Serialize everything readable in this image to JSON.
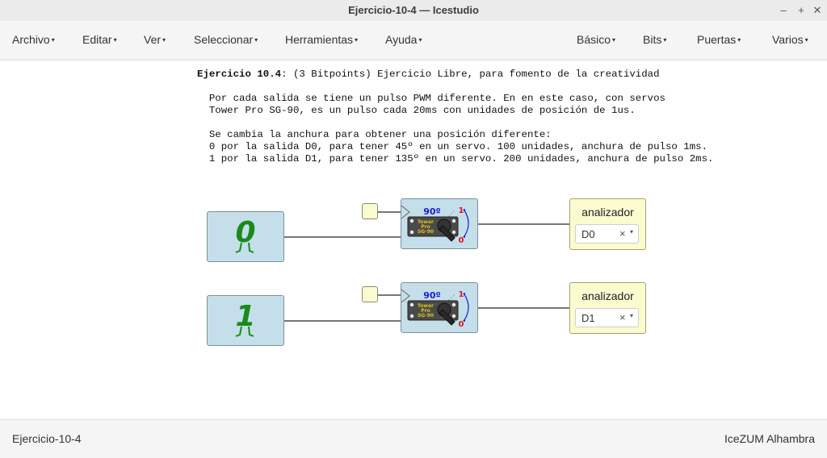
{
  "window": {
    "title": "Ejercicio-10-4 — Icestudio",
    "controls": {
      "minimize": "–",
      "maximize": "+",
      "close": "✕"
    }
  },
  "menu": {
    "archivo": "Archivo",
    "editar": "Editar",
    "ver": "Ver",
    "seleccionar": "Seleccionar",
    "herramientas": "Herramientas",
    "ayuda": "Ayuda",
    "basico": "Básico",
    "bits": "Bits",
    "puertas": "Puertas",
    "varios": "Varios",
    "caret": "▾"
  },
  "note": {
    "heading_bold": "Ejercicio 10.4",
    "heading_rest": ": (3 Bitpoints) Ejercicio Libre, para fomento de la creatividad",
    "lines": [
      "  Por cada salida se tiene un pulso PWM diferente. En en este caso, con servos",
      "  Tower Pro SG-90, es un pulso cada 20ms con unidades de posición de 1us.",
      " ",
      "  Se cambia la anchura para obtener una posición diferente:",
      "  0 por la salida D0, para tener 45º en un servo. 100 unidades, anchura de pulso 1ms.",
      "  1 por la salida D1, para tener 135º en un servo. 200 unidades, anchura de pulso 2ms."
    ]
  },
  "circuit": {
    "const_top": "0",
    "const_bottom": "1",
    "servo": {
      "angle_label": "90º",
      "one_label": "1",
      "zero_label": "0",
      "brand_line1": "Tower",
      "brand_line2": "Pro",
      "brand_line3": "SG-90"
    },
    "analyzer_top": {
      "label": "analizador",
      "value": "D0",
      "clear": "×",
      "dropdown": "▾"
    },
    "analyzer_bottom": {
      "label": "analizador",
      "value": "D1",
      "clear": "×",
      "dropdown": "▾"
    }
  },
  "colors": {
    "block_fill": "#c4dfe9",
    "analyzer_fill": "#fbfbcf",
    "const_green": "#1b8a1b",
    "servo_blue": "#1a1ad6",
    "servo_red": "#e0141e"
  },
  "status": {
    "project": "Ejercicio-10-4",
    "board": "IceZUM Alhambra"
  }
}
